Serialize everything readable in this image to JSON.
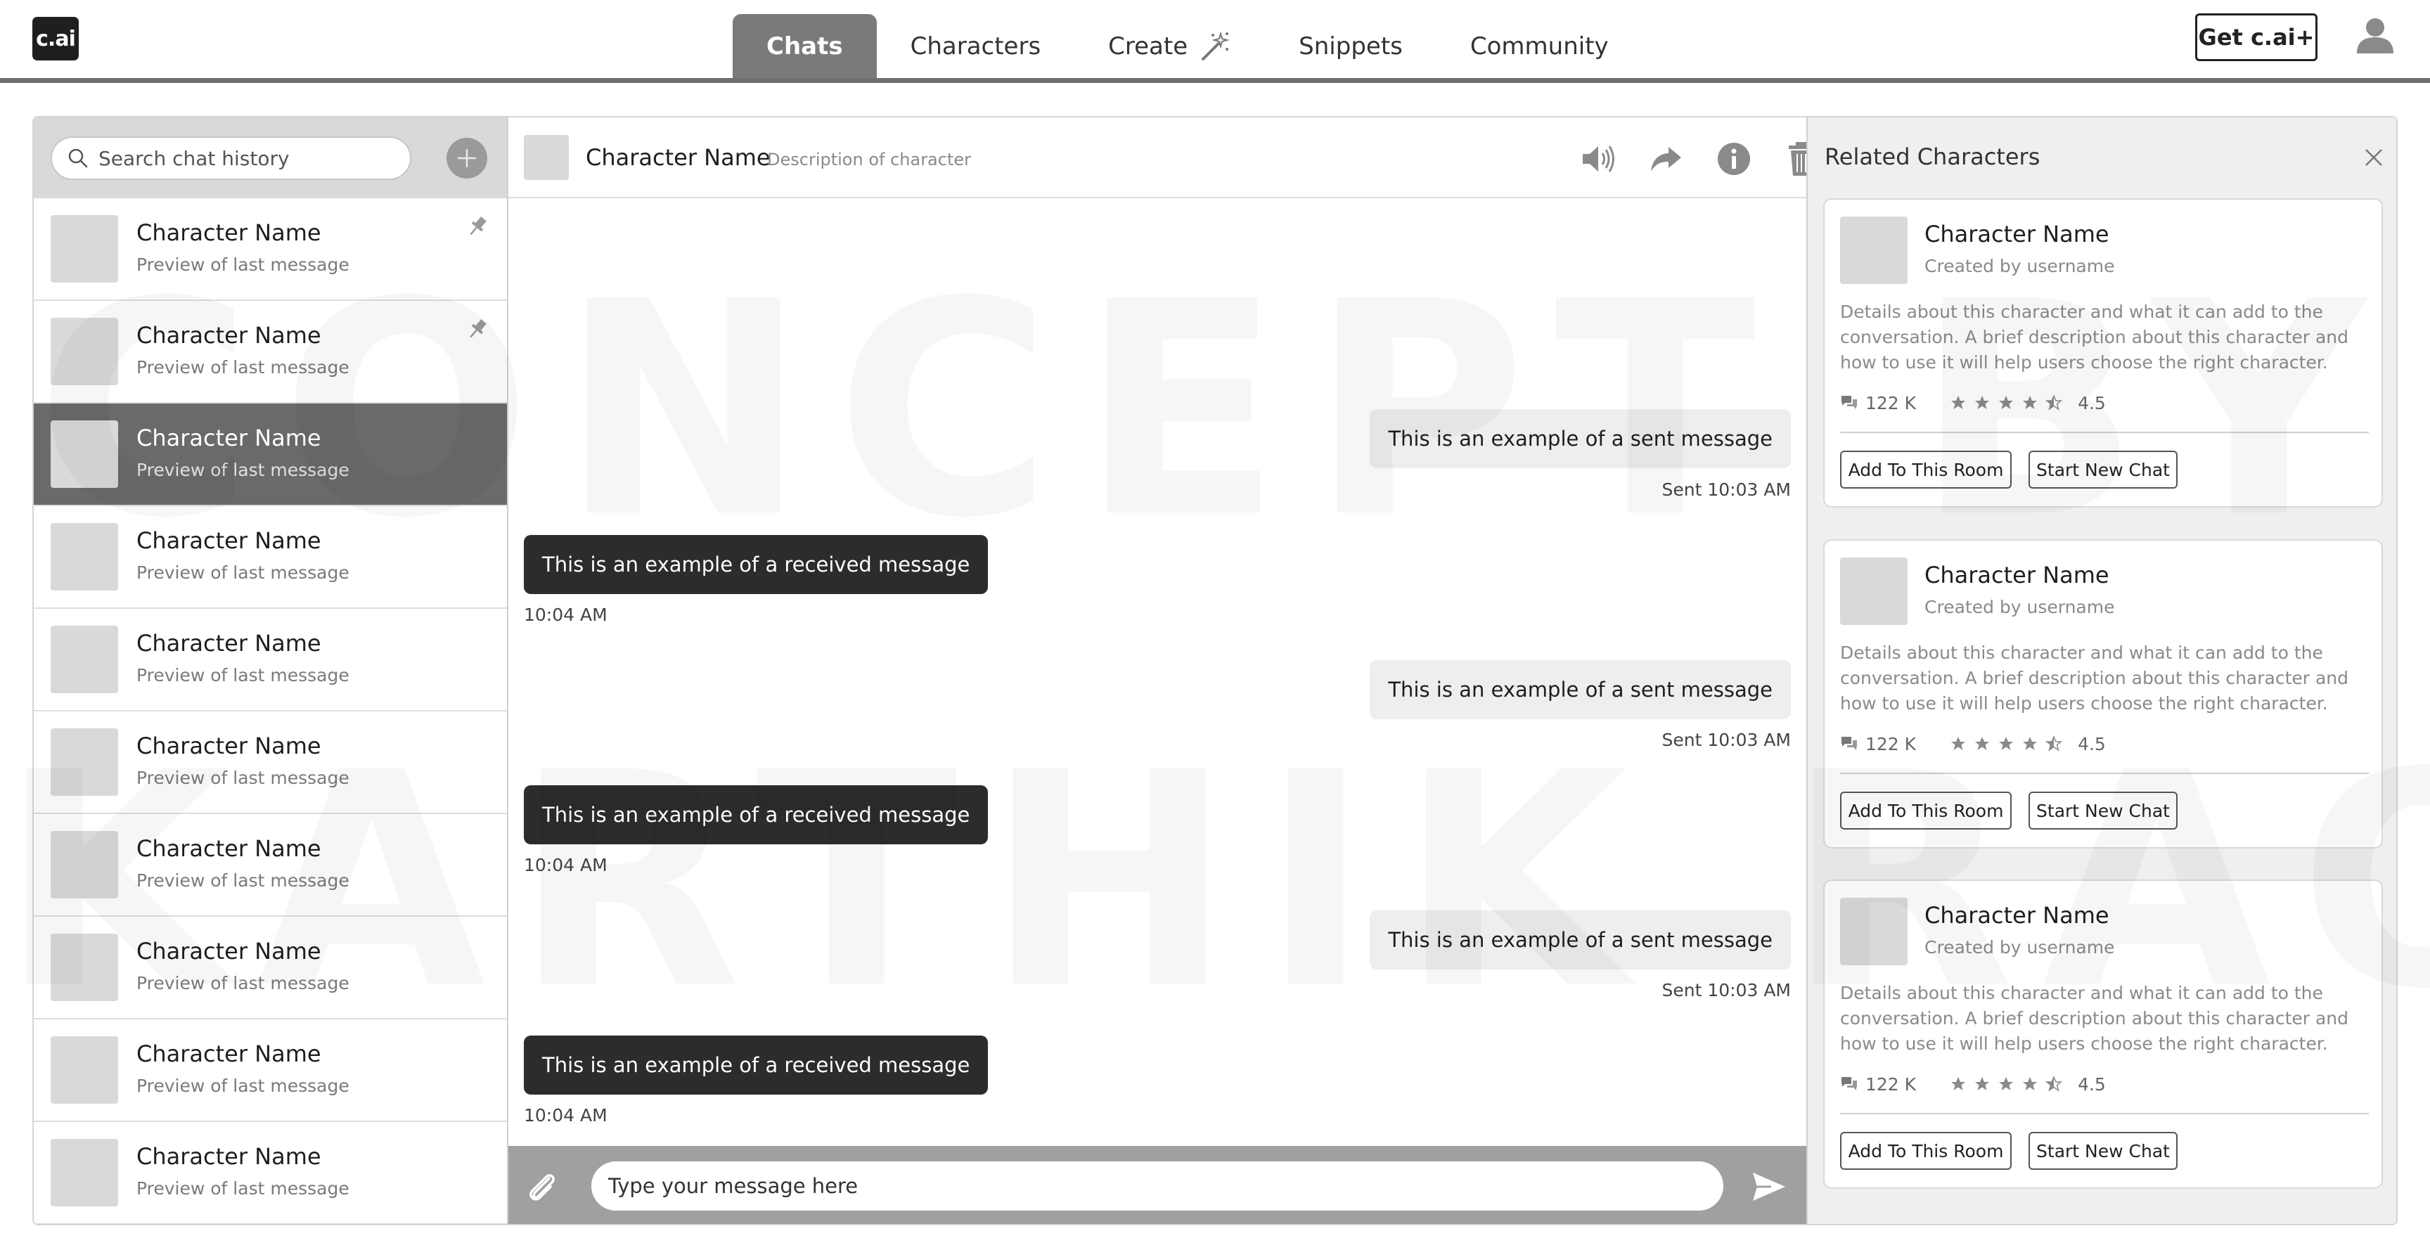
{
  "app": {
    "logo": "c.ai",
    "get_plus": "Get c.ai+"
  },
  "nav": {
    "tabs": [
      "Chats",
      "Characters",
      "Create",
      "Snippets",
      "Community"
    ],
    "active": "Chats"
  },
  "watermark": {
    "line1": "CONCEPT BY",
    "line2": "KARTHIK RAO"
  },
  "sidebar": {
    "search_placeholder": "Search chat history",
    "chats": [
      {
        "name": "Character Name",
        "preview": "Preview of last message",
        "pinned": true
      },
      {
        "name": "Character Name",
        "preview": "Preview of last message",
        "pinned": true
      },
      {
        "name": "Character Name",
        "preview": "Preview of last message",
        "active": true
      },
      {
        "name": "Character Name",
        "preview": "Preview of last message"
      },
      {
        "name": "Character Name",
        "preview": "Preview of last message"
      },
      {
        "name": "Character Name",
        "preview": "Preview of last message"
      },
      {
        "name": "Character Name",
        "preview": "Preview of last message"
      },
      {
        "name": "Character Name",
        "preview": "Preview of last message"
      },
      {
        "name": "Character Name",
        "preview": "Preview of last message"
      },
      {
        "name": "Character Name",
        "preview": "Preview of last message"
      }
    ]
  },
  "chat": {
    "header_name": "Character Name",
    "header_desc": "Description of character",
    "messages": [
      {
        "type": "sent",
        "text": "This is an example of a sent message",
        "time": "Sent 10:03 AM"
      },
      {
        "type": "received",
        "text": "This is an example of a received message",
        "time": "10:04 AM"
      },
      {
        "type": "sent",
        "text": "This is an example of a sent message",
        "time": "Sent 10:03 AM"
      },
      {
        "type": "received",
        "text": "This is an example of a received message",
        "time": "10:04 AM"
      },
      {
        "type": "sent",
        "text": "This is an example of a sent message",
        "time": "Sent 10:03 AM"
      },
      {
        "type": "received",
        "text": "This is an example of a received message",
        "time": "10:04 AM"
      }
    ],
    "input_placeholder": "Type your message here"
  },
  "related": {
    "title": "Related Characters",
    "cards": [
      {
        "name": "Character Name",
        "by": "Created by username",
        "details": "Details about this character and what it can add to the conversation. A brief description about this character and how to use it will help users choose the right character.",
        "chats": "122 K",
        "rating": "4.5",
        "stars": 4.5,
        "add_label": "Add To This Room",
        "start_label": "Start New Chat"
      },
      {
        "name": "Character Name",
        "by": "Created by username",
        "details": "Details about this character and what it can add to the conversation. A brief description about this character and how to use it will help users choose the right character.",
        "chats": "122 K",
        "rating": "4.5",
        "stars": 4.5,
        "add_label": "Add To This Room",
        "start_label": "Start New Chat"
      },
      {
        "name": "Character Name",
        "by": "Created by username",
        "details": "Details about this character and what it can add to the conversation. A brief description about this character and how to use it will help users choose the right character.",
        "chats": "122 K",
        "rating": "4.5",
        "stars": 4.5,
        "add_label": "Add To This Room",
        "start_label": "Start New Chat"
      }
    ]
  }
}
